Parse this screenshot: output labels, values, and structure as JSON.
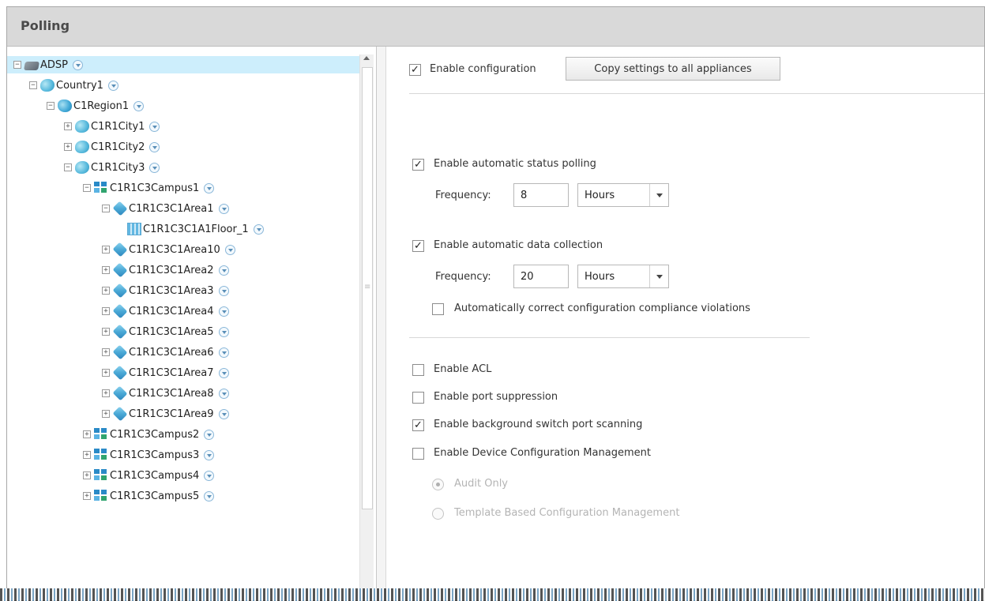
{
  "window": {
    "title": "Polling"
  },
  "tree": {
    "nodes": [
      {
        "label": "ADSP",
        "exp": "⊟"
      },
      {
        "label": "Country1",
        "exp": "⊟"
      },
      {
        "label": "C1Region1",
        "exp": "⊟"
      },
      {
        "label": "C1R1City1",
        "exp": "⊞"
      },
      {
        "label": "C1R1City2",
        "exp": "⊞"
      },
      {
        "label": "C1R1City3",
        "exp": "⊟"
      },
      {
        "label": "C1R1C3Campus1",
        "exp": "⊟"
      },
      {
        "label": "C1R1C3C1Area1",
        "exp": "⊟"
      },
      {
        "label": "C1R1C3C1A1Floor_1",
        "exp": ""
      },
      {
        "label": "C1R1C3C1Area10",
        "exp": "⊞"
      },
      {
        "label": "C1R1C3C1Area2",
        "exp": "⊞"
      },
      {
        "label": "C1R1C3C1Area3",
        "exp": "⊞"
      },
      {
        "label": "C1R1C3C1Area4",
        "exp": "⊞"
      },
      {
        "label": "C1R1C3C1Area5",
        "exp": "⊞"
      },
      {
        "label": "C1R1C3C1Area6",
        "exp": "⊞"
      },
      {
        "label": "C1R1C3C1Area7",
        "exp": "⊞"
      },
      {
        "label": "C1R1C3C1Area8",
        "exp": "⊞"
      },
      {
        "label": "C1R1C3C1Area9",
        "exp": "⊞"
      },
      {
        "label": "C1R1C3Campus2",
        "exp": "⊞"
      },
      {
        "label": "C1R1C3Campus3",
        "exp": "⊞"
      },
      {
        "label": "C1R1C3Campus4",
        "exp": "⊞"
      },
      {
        "label": "C1R1C3Campus5",
        "exp": "⊞"
      }
    ]
  },
  "config": {
    "enable_configuration": {
      "label": "Enable configuration",
      "checked": true
    },
    "copy_button": "Copy settings to all appliances",
    "status_polling": {
      "label": "Enable automatic status polling",
      "checked": true,
      "frequency_label": "Frequency:",
      "frequency_value": "8",
      "unit": "Hours"
    },
    "data_collection": {
      "label": "Enable automatic data collection",
      "checked": true,
      "frequency_label": "Frequency:",
      "frequency_value": "20",
      "unit": "Hours",
      "auto_correct_label": "Automatically correct configuration compliance violations",
      "auto_correct_checked": false
    },
    "enable_acl": {
      "label": "Enable ACL",
      "checked": false
    },
    "port_suppression": {
      "label": "Enable port suppression",
      "checked": false
    },
    "switch_port_scanning": {
      "label": "Enable background switch port scanning",
      "checked": true
    },
    "device_config_mgmt": {
      "label": "Enable Device Configuration Management",
      "checked": false
    },
    "audit_only": {
      "label": "Audit Only",
      "selected": true
    },
    "template_based": {
      "label": "Template Based Configuration Management",
      "selected": false
    }
  }
}
